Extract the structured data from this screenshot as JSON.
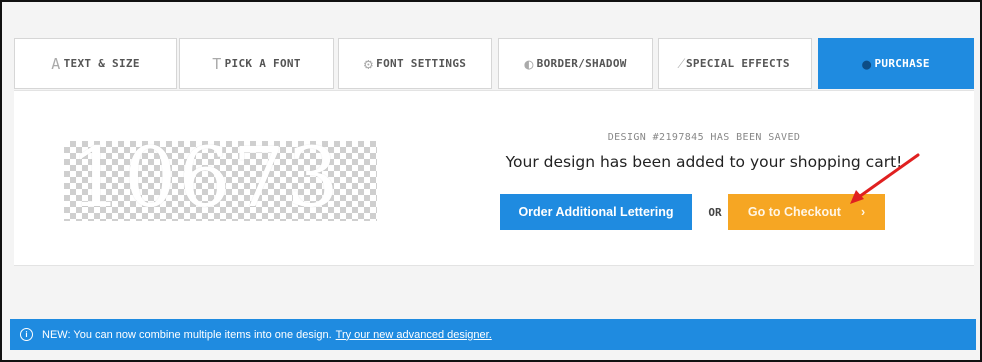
{
  "tabs": [
    {
      "label": "TEXT & SIZE",
      "icon": "text-size-icon",
      "glyph": "A"
    },
    {
      "label": "PICK A FONT",
      "icon": "font-icon",
      "glyph": "T"
    },
    {
      "label": "FONT SETTINGS",
      "icon": "gear-icon",
      "glyph": "⚙"
    },
    {
      "label": "BORDER/SHADOW",
      "icon": "border-shadow-icon",
      "glyph": "◐"
    },
    {
      "label": "SPECIAL EFFECTS",
      "icon": "wand-icon",
      "glyph": "⁄"
    },
    {
      "label": "PURCHASE",
      "icon": "cart-icon",
      "glyph": "●",
      "active": true
    }
  ],
  "preview": {
    "text": "10673"
  },
  "saved_message": "DESIGN #2197845 HAS BEEN SAVED",
  "added_message": "Your design has been added to your shopping cart!",
  "buttons": {
    "order": "Order Additional Lettering",
    "or": "OR",
    "checkout": "Go to Checkout",
    "checkout_chevron": "›"
  },
  "banner": {
    "text": "NEW: You can now combine multiple items into one design.",
    "link": "Try our new advanced designer."
  },
  "colors": {
    "accent": "#1f8be0",
    "checkout": "#f6a623",
    "arrow": "#e02020"
  }
}
